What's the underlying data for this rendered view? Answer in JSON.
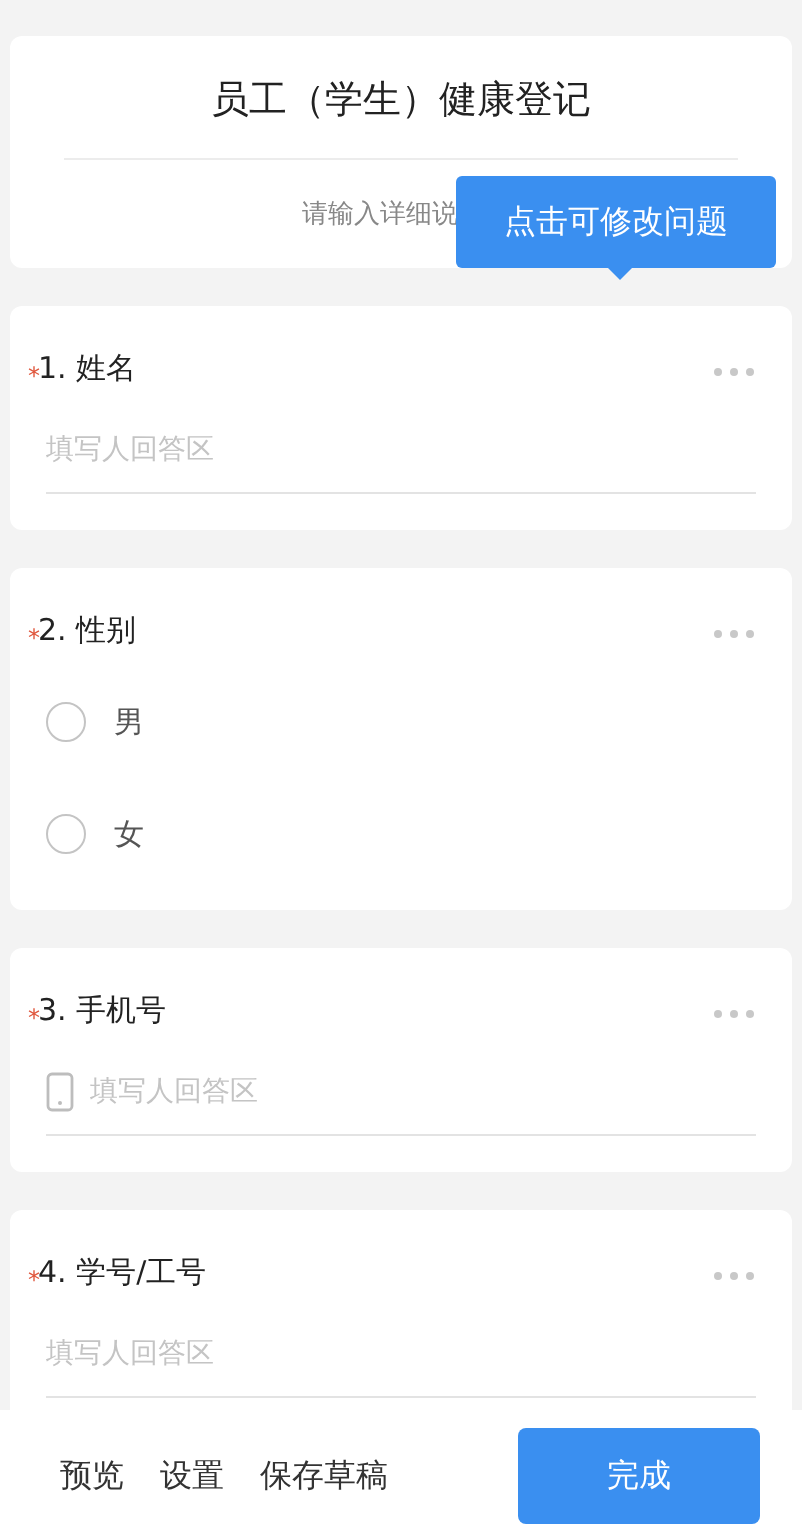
{
  "header": {
    "title": "员工（学生）健康登记",
    "description": "请输入详细说"
  },
  "tooltip": {
    "text": "点击可修改问题"
  },
  "questions": [
    {
      "kind": "text",
      "number": "1.",
      "title": "姓名",
      "required_mark": "*",
      "placeholder": "填写人回答区"
    },
    {
      "kind": "choice",
      "number": "2.",
      "title": "性别",
      "required_mark": "*",
      "options": [
        {
          "label": "男",
          "selected": false
        },
        {
          "label": "女",
          "selected": false
        }
      ]
    },
    {
      "kind": "phone",
      "number": "3.",
      "title": "手机号",
      "required_mark": "*",
      "placeholder": "填写人回答区"
    },
    {
      "kind": "text",
      "number": "4.",
      "title": "学号/工号",
      "required_mark": "*",
      "placeholder": "填写人回答区"
    }
  ],
  "footer": {
    "links": [
      "预览",
      "设置",
      "保存草稿"
    ],
    "primary": "完成"
  }
}
